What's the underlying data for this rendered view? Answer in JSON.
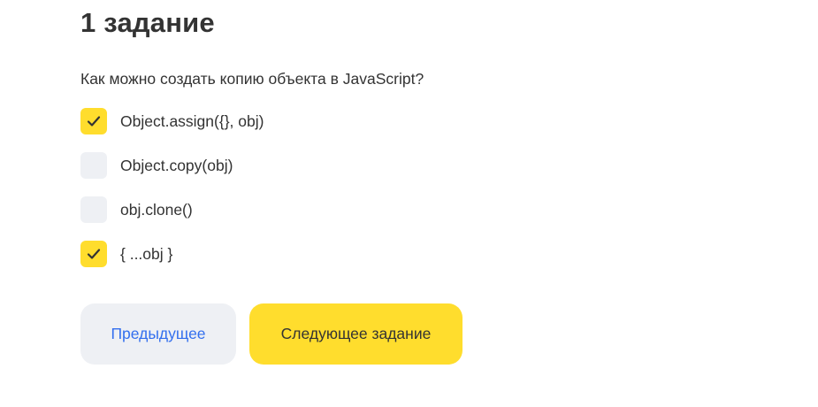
{
  "task": {
    "title": "1 задание",
    "question": "Как можно создать копию объекта в JavaScript?"
  },
  "options": [
    {
      "label": "Object.assign({}, obj)",
      "checked": true
    },
    {
      "label": "Object.copy(obj)",
      "checked": false
    },
    {
      "label": "obj.clone()",
      "checked": false
    },
    {
      "label": "{ ...obj }",
      "checked": true
    }
  ],
  "navigation": {
    "prev_label": "Предыдущее",
    "next_label": "Следующее задание"
  },
  "colors": {
    "accent": "#ffdd2d",
    "checkbox_bg": "#eef0f4",
    "link": "#336fee",
    "text": "#333333"
  },
  "icons": {
    "checkbox_mark": "check-icon"
  }
}
